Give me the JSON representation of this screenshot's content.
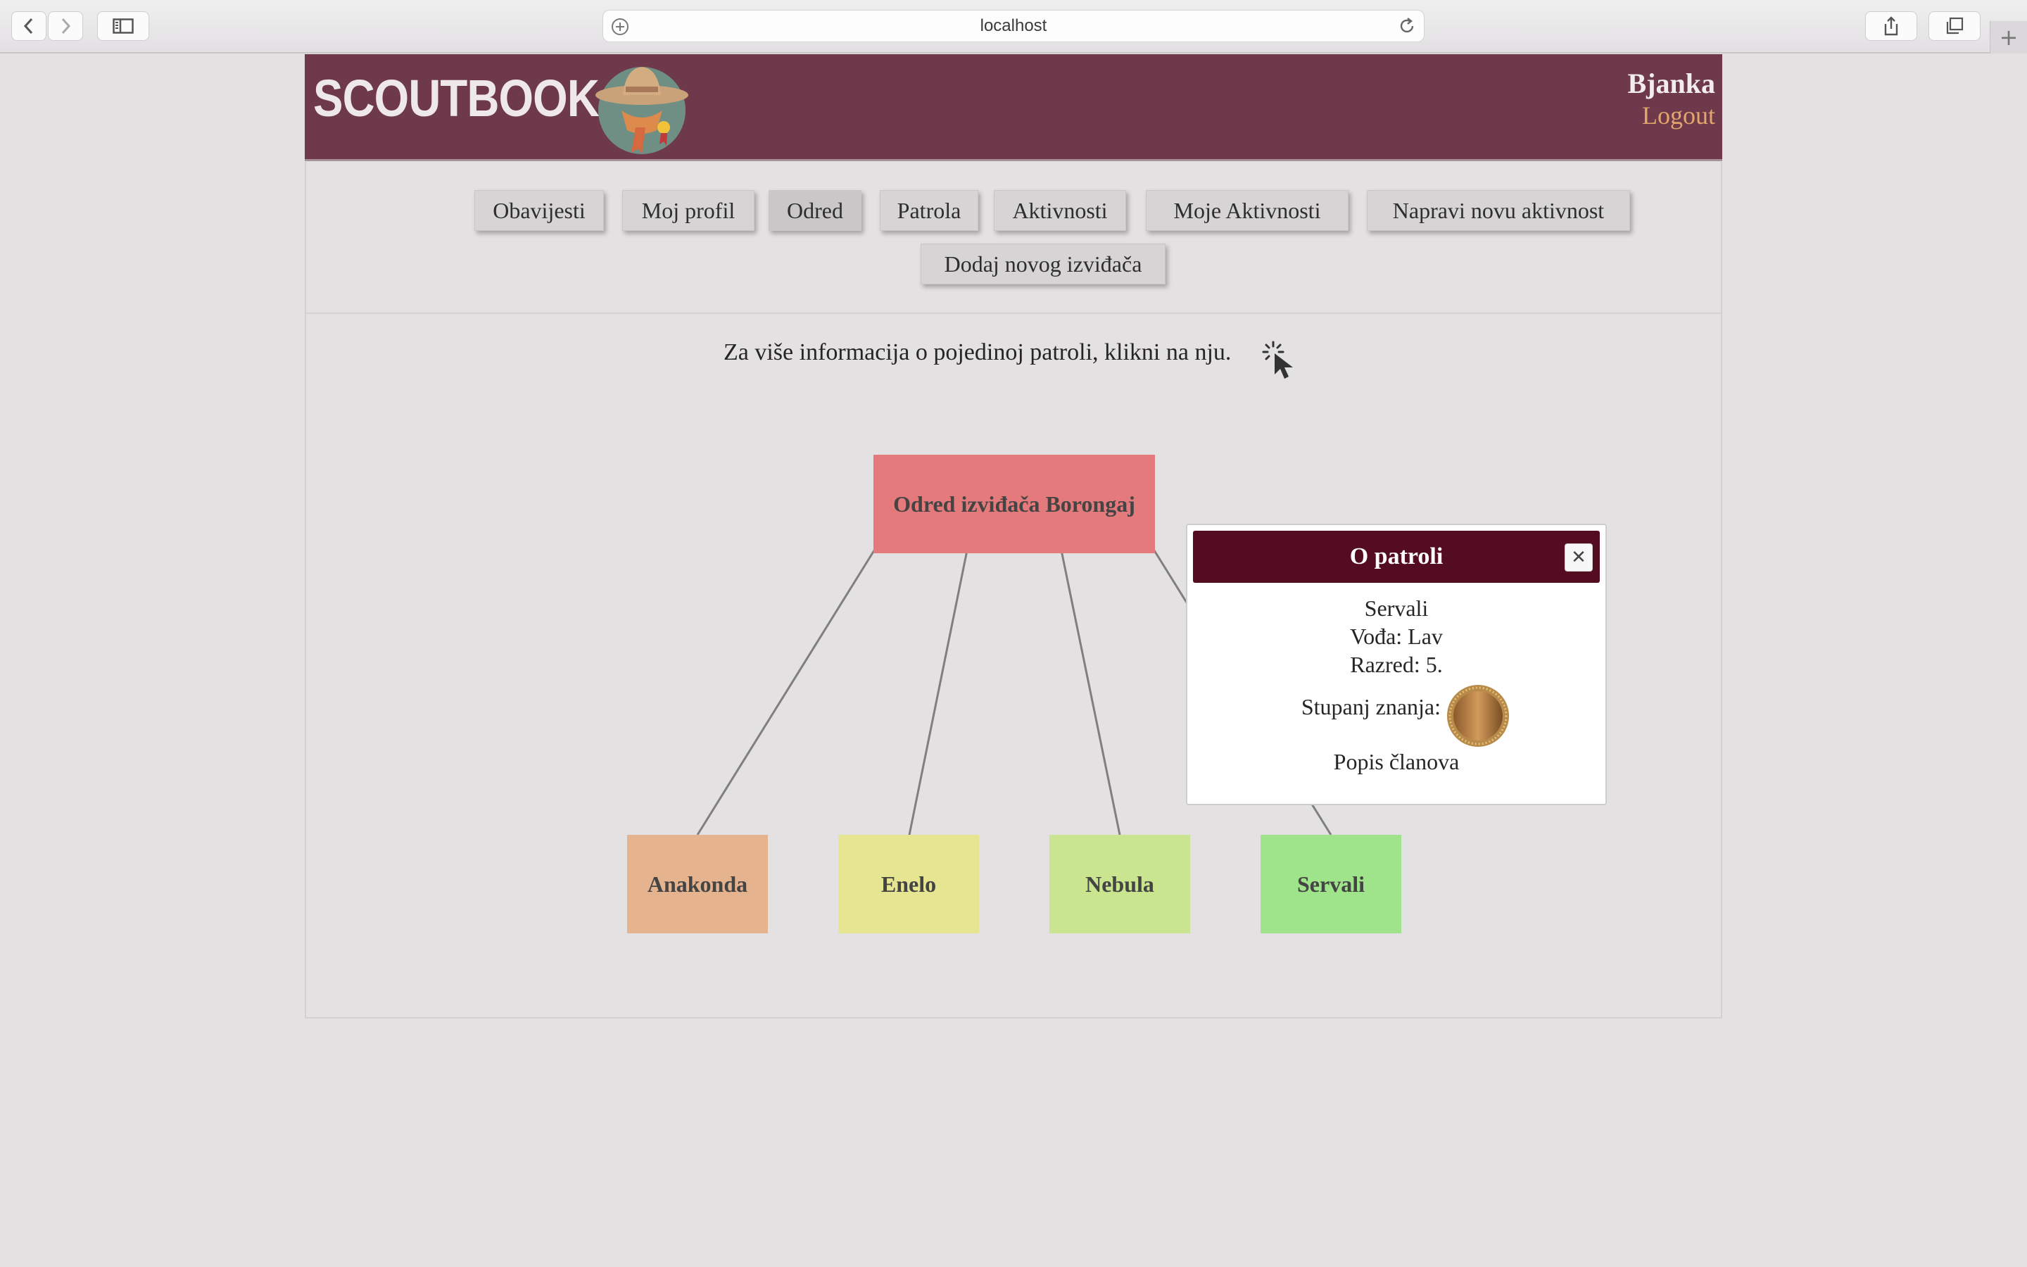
{
  "browser": {
    "url": "localhost"
  },
  "header": {
    "brand": "SCOUTBOOK",
    "user": "Bjanka",
    "logout": "Logout"
  },
  "nav": {
    "items": [
      {
        "label": "Obavijesti"
      },
      {
        "label": "Moj profil"
      },
      {
        "label": "Odred"
      },
      {
        "label": "Patrola"
      },
      {
        "label": "Aktivnosti"
      },
      {
        "label": "Moje Aktivnosti"
      },
      {
        "label": "Napravi novu aktivnost"
      },
      {
        "label": "Dodaj novog izviđača"
      }
    ],
    "active": "Odred"
  },
  "main": {
    "hint": "Za više informacija o pojedinoj patroli, klikni na nju.",
    "tree": {
      "root": {
        "label": "Odred izviđača Borongaj",
        "color": "#e47a7b"
      },
      "patrols": [
        {
          "label": "Anakonda",
          "color": "#e6b38f"
        },
        {
          "label": "Enelo",
          "color": "#e6e591"
        },
        {
          "label": "Nebula",
          "color": "#c9e58f"
        },
        {
          "label": "Servali",
          "color": "#9fe38a"
        }
      ]
    }
  },
  "popup": {
    "title": "O patroli",
    "name": "Servali",
    "leader": "Vođa: Lav",
    "grade": "Razred: 5.",
    "knowledge_label": "Stupanj znanja:",
    "knowledge_icon": "bronze-medal-icon",
    "members_link": "Popis članova"
  }
}
